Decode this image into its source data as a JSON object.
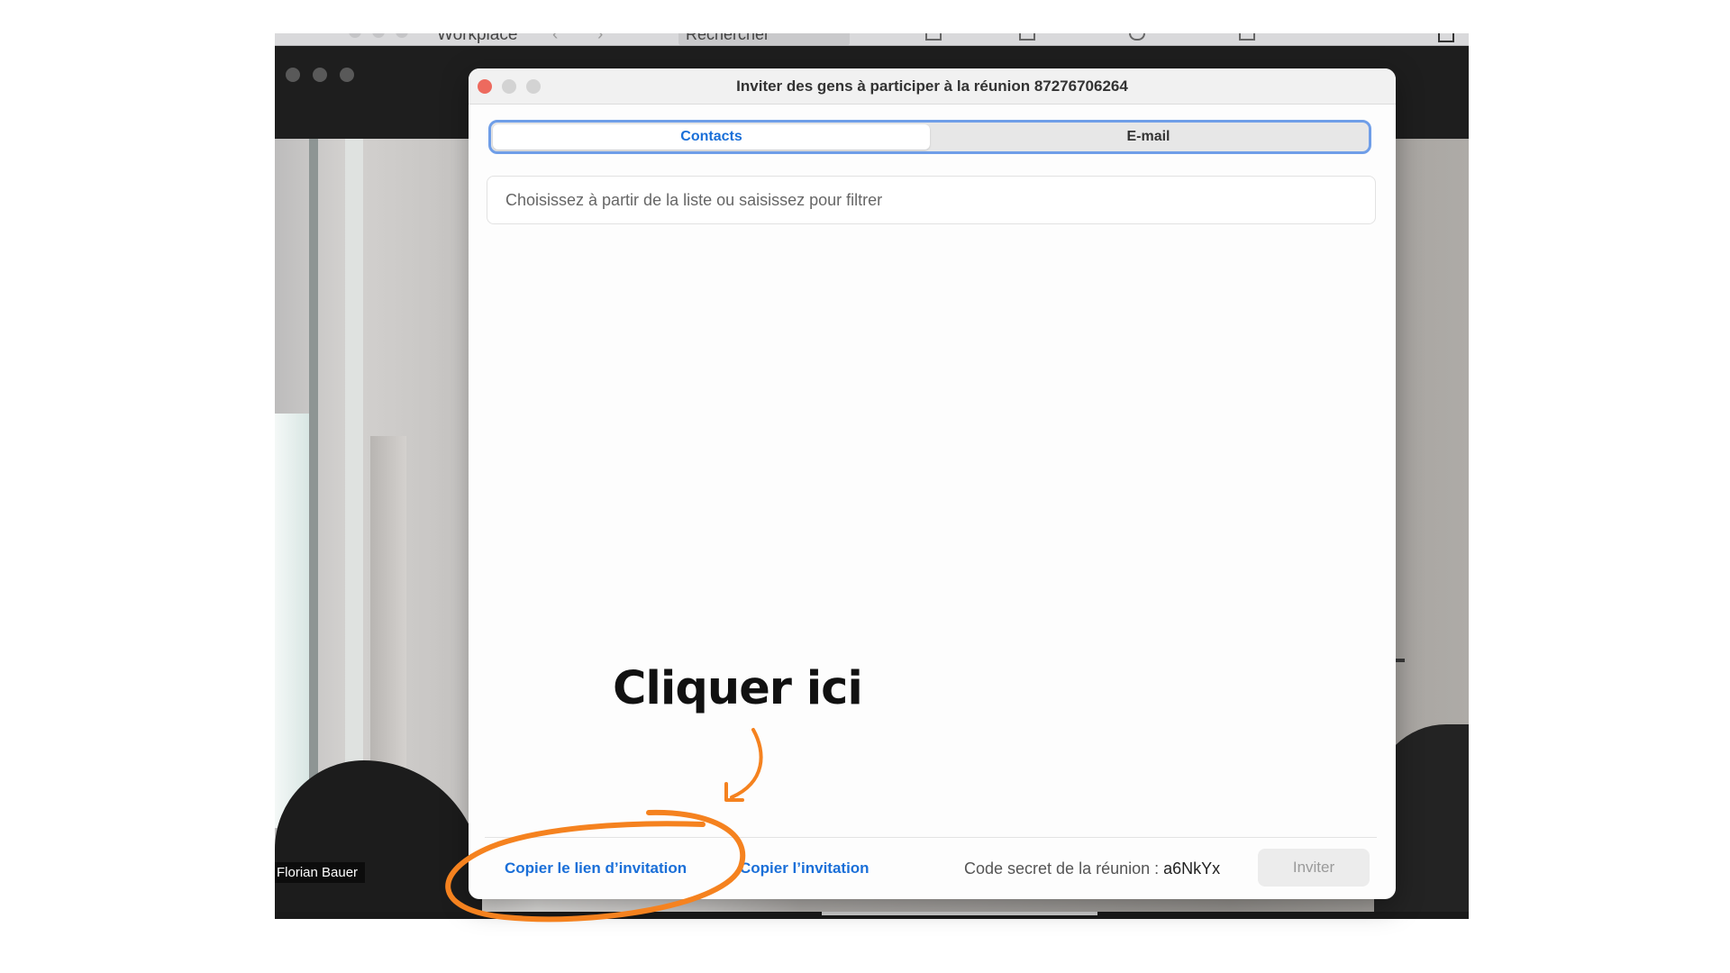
{
  "background": {
    "top_bar": {
      "app_name": "Workplace",
      "search_label": "Rechercher"
    },
    "participant_name": "Florian Bauer"
  },
  "dialog": {
    "title": "Inviter des gens à participer à la réunion 87276706264",
    "tabs": [
      {
        "label": "Contacts",
        "active": true
      },
      {
        "label": "E-mail",
        "active": false
      }
    ],
    "filter": {
      "value": "",
      "placeholder": "Choisissez à partir de la liste ou saisissez pour filtrer"
    },
    "footer": {
      "copy_link_label": "Copier le lien d’invitation",
      "copy_invitation_label": "Copier l’invitation",
      "secret_label": "Code secret de la réunion : ",
      "secret_code": "a6NkYx",
      "invite_label": "Inviter"
    },
    "traffic_light_colors": [
      "#ed6a5e",
      "#d3d3d3",
      "#d3d3d3"
    ]
  },
  "annotation": {
    "text": "Cliquer ici",
    "color": "#f5821f"
  }
}
